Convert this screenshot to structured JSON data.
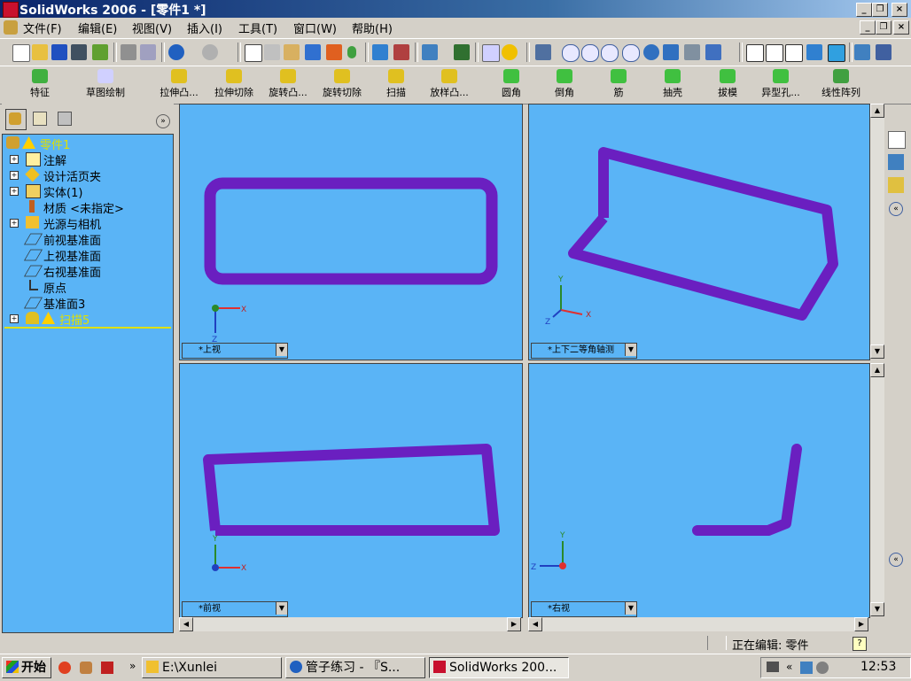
{
  "window": {
    "title": "SolidWorks 2006 - [零件1 *]"
  },
  "menu": [
    "文件(F)",
    "编辑(E)",
    "视图(V)",
    "插入(I)",
    "工具(T)",
    "窗口(W)",
    "帮助(H)"
  ],
  "features_toolbar": {
    "group1": [
      "特征",
      "草图绘制"
    ],
    "items": [
      "拉伸凸...",
      "拉伸切除",
      "旋转凸...",
      "旋转切除",
      "扫描",
      "放样凸...",
      "圆角",
      "倒角",
      "筋",
      "抽壳",
      "拔模",
      "异型孔...",
      "线性阵列"
    ]
  },
  "tree": [
    {
      "label": "零件1",
      "warn": true
    },
    {
      "label": "注解"
    },
    {
      "label": "设计活页夹"
    },
    {
      "label": "实体(1)"
    },
    {
      "label": "材质 <未指定>"
    },
    {
      "label": "光源与相机"
    },
    {
      "label": "前视基准面"
    },
    {
      "label": "上视基准面"
    },
    {
      "label": "右视基准面"
    },
    {
      "label": "原点"
    },
    {
      "label": "基准面3"
    },
    {
      "label": "扫描5",
      "warn": true
    }
  ],
  "viewports": {
    "top_left": "*上视",
    "top_right": "*上下二等角轴测",
    "bottom_left": "*前视",
    "bottom_right": "*右视"
  },
  "status": {
    "text": "正在编辑: 零件",
    "help": "?"
  },
  "taskbar": {
    "start": "开始",
    "tasks": [
      "E:\\Xunlei",
      "管子练习 - 『S...",
      "SolidWorks 200..."
    ],
    "clock": "12:53"
  },
  "colors": {
    "viewport_bg": "#5ab4f6",
    "pipe": "#6a1fc0",
    "titlebar": "#0a246a"
  }
}
